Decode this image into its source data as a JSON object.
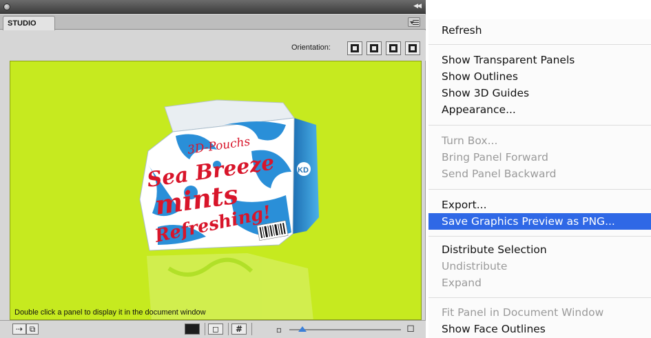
{
  "panel": {
    "tab_label": "STUDIO",
    "orientation_label": "Orientation:",
    "status_text": "Double click a panel to display it in the document window",
    "zoom_level": 0.12
  },
  "artwork": {
    "line1": "3D-Pouchs",
    "line2": "Sea Breeze",
    "line3": "mints",
    "line4": "Refreshing!",
    "logo": "KD"
  },
  "menu": {
    "items": [
      {
        "label": "Refresh",
        "enabled": true
      },
      {
        "label": "Show Transparent Panels",
        "enabled": true
      },
      {
        "label": "Show Outlines",
        "enabled": true
      },
      {
        "label": "Show 3D Guides",
        "enabled": true
      },
      {
        "label": "Appearance...",
        "enabled": true
      },
      {
        "label": "Turn Box...",
        "enabled": false
      },
      {
        "label": "Bring Panel Forward",
        "enabled": false
      },
      {
        "label": "Send Panel Backward",
        "enabled": false
      },
      {
        "label": "Export...",
        "enabled": true
      },
      {
        "label": "Save Graphics Preview as PNG...",
        "enabled": true,
        "highlighted": true
      },
      {
        "label": "Distribute Selection",
        "enabled": true
      },
      {
        "label": "Undistribute",
        "enabled": false
      },
      {
        "label": "Expand",
        "enabled": false
      },
      {
        "label": "Fit Panel in Document Window",
        "enabled": false
      },
      {
        "label": "Show Face Outlines",
        "enabled": true
      }
    ]
  },
  "colors": {
    "viewport_bg": "#c6ea1f",
    "highlight": "#2f68e6",
    "package_blue": "#2a8fd8",
    "text_red": "#d8152a"
  }
}
